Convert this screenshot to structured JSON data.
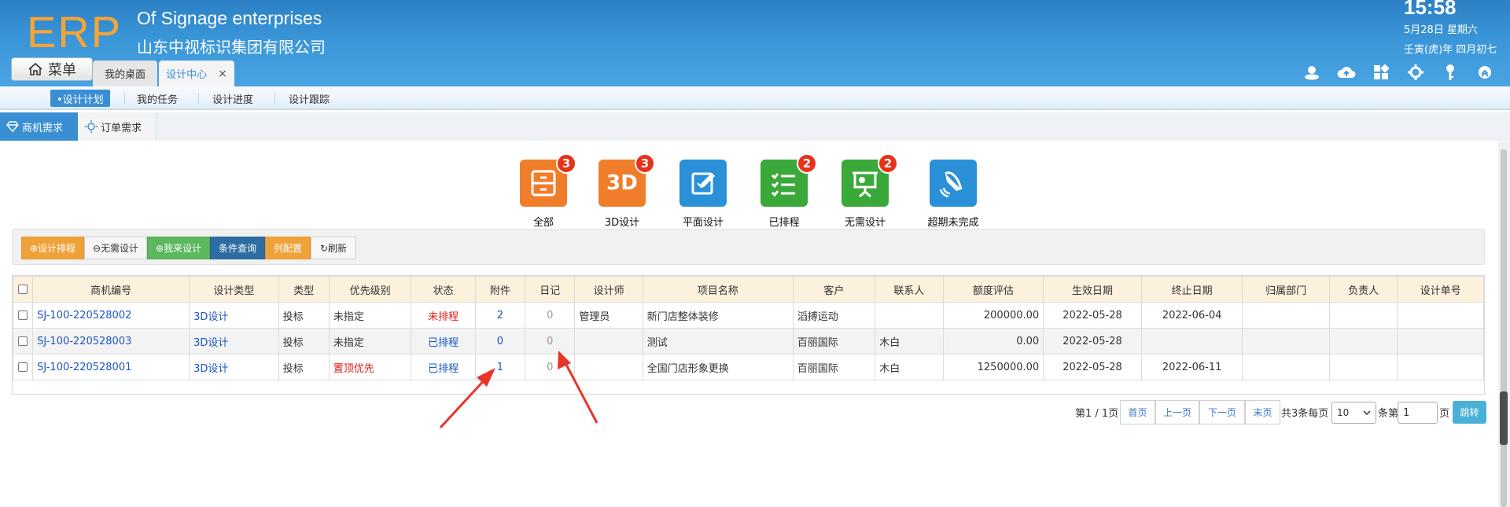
{
  "header": {
    "logo": "ERP",
    "company_en": "Of Signage enterprises",
    "company_cn": "山东中视标识集团有限公司",
    "time": "15:58",
    "date": "5月28日 星期六",
    "lunar": "壬寅(虎)年 四月初七"
  },
  "menu": {
    "label": "菜单",
    "icon": "home-icon"
  },
  "tabs": [
    {
      "label": "我的桌面"
    },
    {
      "label": "设计中心",
      "close": "×"
    }
  ],
  "toolbar_icons": [
    "user-icon",
    "cloud-icon",
    "apps-icon",
    "gear-icon",
    "key-icon",
    "collapse-icon"
  ],
  "subnav": [
    {
      "label": "•设计计划",
      "active": true
    },
    {
      "label": "我的任务"
    },
    {
      "label": "设计进度"
    },
    {
      "label": "设计跟踪"
    }
  ],
  "category_tabs": [
    {
      "label": "商机需求",
      "icon": "diamond-icon"
    },
    {
      "label": "订单需求",
      "icon": "sun-icon"
    }
  ],
  "tiles": [
    {
      "label": "全部",
      "badge": "3",
      "icon": "cabinet-icon",
      "color": "#f07d2a"
    },
    {
      "label": "3D设计",
      "badge": "3",
      "icon": "3d-icon",
      "glyph": "3D",
      "color": "#f07d2a"
    },
    {
      "label": "平面设计",
      "badge": "",
      "icon": "edit-icon",
      "color": "#2a90d8"
    },
    {
      "label": "已排程",
      "badge": "2",
      "icon": "checklist-icon",
      "color": "#3ba83a"
    },
    {
      "label": "无需设计",
      "badge": "2",
      "icon": "presentation-icon",
      "color": "#3ba83a"
    },
    {
      "label": "超期未完成",
      "badge": "",
      "icon": "bell-icon",
      "color": "#2a90d8"
    }
  ],
  "actions": [
    {
      "label": "设计排程",
      "icon": "⊕",
      "color": "#f0a23a"
    },
    {
      "label": "无需设计",
      "icon": "⊖",
      "color": "#f7f7f7"
    },
    {
      "label": "我来设计",
      "icon": "⊕",
      "color": "#5cb85c"
    },
    {
      "label": "条件查询",
      "icon": "",
      "color": "#2e6da4"
    },
    {
      "label": "列配置",
      "icon": "",
      "color": "#f0a23a"
    },
    {
      "label": "刷新",
      "icon": "↻",
      "color": "#f7f7f7"
    }
  ],
  "table": {
    "columns": [
      "商机编号",
      "设计类型",
      "类型",
      "优先级别",
      "状态",
      "附件",
      "日记",
      "设计师",
      "项目名称",
      "客户",
      "联系人",
      "额度评估",
      "生效日期",
      "终止日期",
      "归属部门",
      "负责人",
      "设计单号"
    ],
    "rows": [
      {
        "id": "SJ-100-220528002",
        "design_type": "3D设计",
        "type": "投标",
        "priority": "未指定",
        "status": "未排程",
        "attach": "2",
        "diary": "0",
        "designer": "管理员",
        "project": "新门店整体装修",
        "customer": "滔搏运动",
        "contact": "",
        "amount": "200000.00",
        "start": "2022-05-28",
        "end": "2022-06-04",
        "dept": "",
        "owner": "",
        "design_no": ""
      },
      {
        "id": "SJ-100-220528003",
        "design_type": "3D设计",
        "type": "投标",
        "priority": "未指定",
        "status": "已排程",
        "attach": "0",
        "diary": "0",
        "designer": "",
        "project": "测试",
        "customer": "百丽国际",
        "contact": "木白",
        "amount": "0.00",
        "start": "2022-05-28",
        "end": "",
        "dept": "",
        "owner": "",
        "design_no": ""
      },
      {
        "id": "SJ-100-220528001",
        "design_type": "3D设计",
        "type": "投标",
        "priority": "置顶优先",
        "status": "已排程",
        "attach": "1",
        "diary": "0",
        "designer": "",
        "project": "全国门店形象更换",
        "customer": "百丽国际",
        "contact": "木白",
        "amount": "1250000.00",
        "start": "2022-05-28",
        "end": "2022-06-11",
        "dept": "",
        "owner": "",
        "design_no": ""
      }
    ]
  },
  "pager": {
    "page_info": "第1 / 1页",
    "first": "首页",
    "prev": "上一页",
    "next": "下一页",
    "last": "末页",
    "total_prefix": "共3条每页",
    "page_size": "10",
    "goto_prefix": "条第",
    "goto_value": "1",
    "goto_suffix": "页",
    "jump": "跳转"
  }
}
